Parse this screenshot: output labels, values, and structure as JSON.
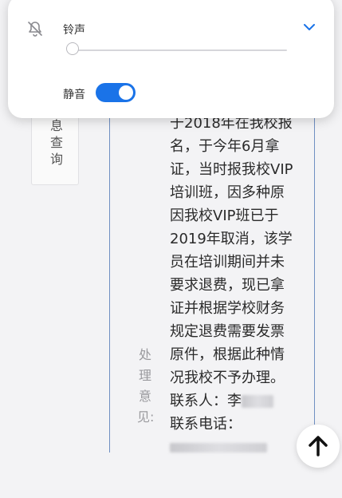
{
  "side_tab": {
    "text": "息查询"
  },
  "record": {
    "field_label": "处理意见:",
    "lines": [
      "于2018年在我校报",
      "名，于今年6月拿",
      "证，当时报我校VIP",
      "培训班，因多种原",
      "因我校VIP班已于",
      "2019年取消，该学",
      "员在培训期间并未",
      "要求退费，现已拿",
      "证并根据学校财务",
      "规定退费需要发票",
      "原件，根据此种情",
      "况我校不予办理。"
    ],
    "contact_person_label": "联系人：李",
    "contact_phone_label": "联系电话："
  },
  "volume_panel": {
    "ringtone_label": "铃声",
    "ringtone_level": 0,
    "mute_label": "静音",
    "mute_on": true,
    "accent_color": "#1a73e8"
  },
  "icons": {
    "mute": "bell-off-icon",
    "expand": "chevron-down-icon",
    "scroll_top": "arrow-up-icon"
  }
}
